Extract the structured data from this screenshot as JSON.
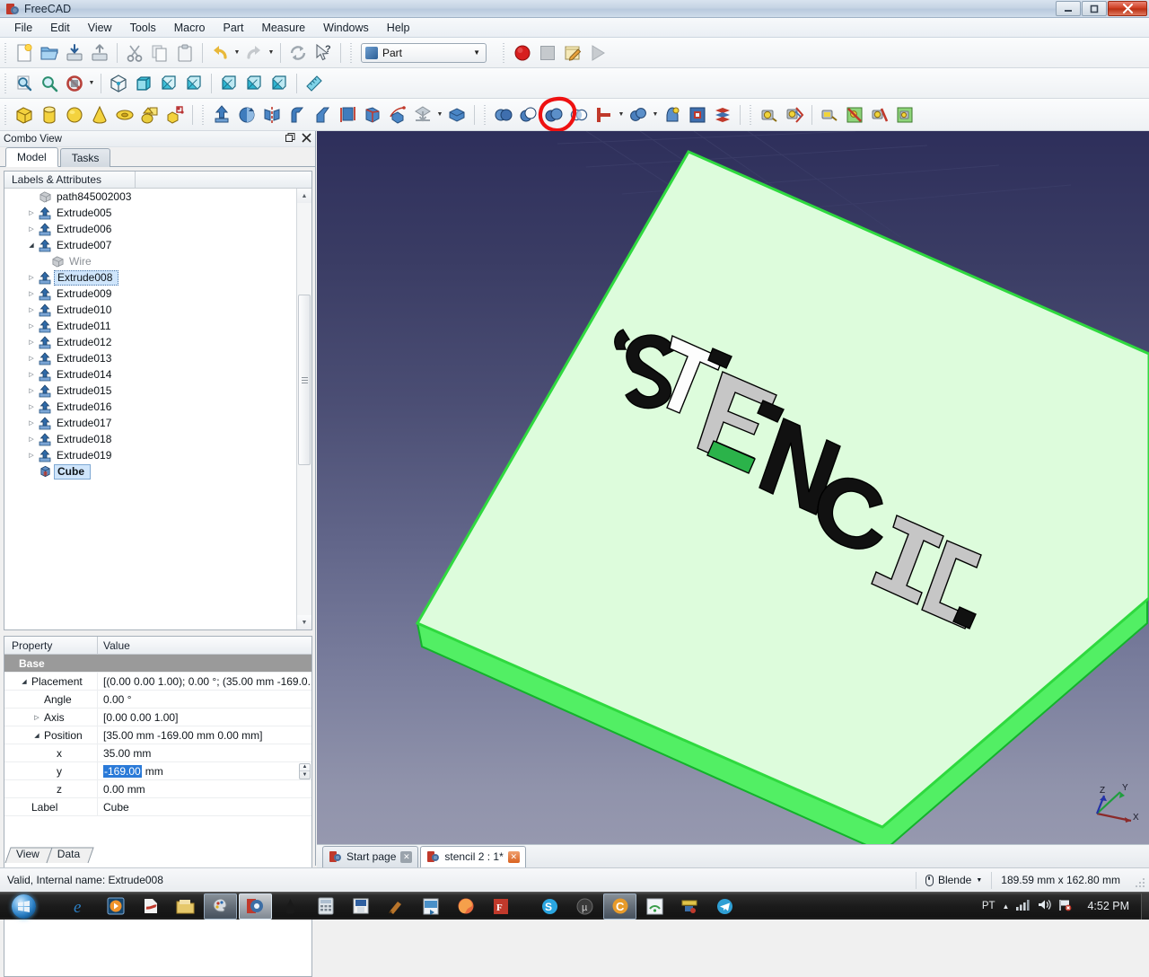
{
  "window": {
    "title": "FreeCAD",
    "app_icon": "freecad-icon",
    "minimize": "–",
    "maximize": "❐",
    "close": "✕"
  },
  "menubar": {
    "items": [
      "File",
      "Edit",
      "View",
      "Tools",
      "Macro",
      "Part",
      "Measure",
      "Windows",
      "Help"
    ]
  },
  "toolbars": {
    "file": [
      {
        "name": "new-document-button",
        "title": "New"
      },
      {
        "name": "open-document-button",
        "title": "Open"
      },
      {
        "name": "save-document-button",
        "title": "Save"
      },
      {
        "name": "save-as-button",
        "title": "Save As"
      },
      {
        "name": "cut-button",
        "title": "Cut"
      },
      {
        "name": "copy-button",
        "title": "Copy"
      },
      {
        "name": "paste-button",
        "title": "Paste"
      },
      {
        "name": "undo-button",
        "title": "Undo"
      },
      {
        "name": "redo-button",
        "title": "Redo"
      },
      {
        "name": "refresh-button",
        "title": "Refresh"
      },
      {
        "name": "whats-this-button",
        "title": "What's This"
      }
    ],
    "workbench": {
      "label": "Part",
      "arrow": "▼"
    },
    "macro": [
      {
        "name": "macro-record-button",
        "title": "Macro recording"
      },
      {
        "name": "macro-stop-button",
        "title": "Stop macro recording"
      },
      {
        "name": "macro-edit-button",
        "title": "Macros"
      },
      {
        "name": "macro-execute-button",
        "title": "Execute macro"
      }
    ],
    "view": [
      {
        "name": "fit-all-button",
        "title": "Fit all"
      },
      {
        "name": "fit-selection-button",
        "title": "Fit selection"
      },
      {
        "name": "draw-style-button",
        "title": "Draw style"
      },
      {
        "name": "isometric-view-button",
        "title": "Isometric"
      },
      {
        "name": "front-view-button",
        "title": "Front"
      },
      {
        "name": "top-view-button",
        "title": "Top"
      },
      {
        "name": "right-view-button",
        "title": "Right"
      },
      {
        "name": "rear-view-button",
        "title": "Rear"
      },
      {
        "name": "bottom-view-button",
        "title": "Bottom"
      },
      {
        "name": "left-view-button",
        "title": "Left"
      },
      {
        "name": "measure-button",
        "title": "Measure"
      }
    ],
    "part_primitives": [
      {
        "name": "box-primitive-button",
        "title": "Box"
      },
      {
        "name": "cylinder-primitive-button",
        "title": "Cylinder"
      },
      {
        "name": "sphere-primitive-button",
        "title": "Sphere"
      },
      {
        "name": "cone-primitive-button",
        "title": "Cone"
      },
      {
        "name": "torus-primitive-button",
        "title": "Torus"
      },
      {
        "name": "create-primitives-button",
        "title": "Create primitives"
      },
      {
        "name": "shape-builder-button",
        "title": "Shape builder"
      }
    ],
    "part_tools": [
      {
        "name": "extrude-button",
        "title": "Extrude"
      },
      {
        "name": "revolve-button",
        "title": "Revolve"
      },
      {
        "name": "mirror-button",
        "title": "Mirror"
      },
      {
        "name": "fillet-button",
        "title": "Fillet"
      },
      {
        "name": "chamfer-button",
        "title": "Chamfer"
      },
      {
        "name": "ruled-surface-button",
        "title": "Ruled surface"
      },
      {
        "name": "loft-button",
        "title": "Loft"
      },
      {
        "name": "sweep-button",
        "title": "Sweep"
      },
      {
        "name": "section-button",
        "title": "Section"
      },
      {
        "name": "offset-button",
        "title": "3D Offset"
      }
    ],
    "boolean": [
      {
        "name": "boolean-button",
        "title": "Boolean"
      },
      {
        "name": "cut-boolean-button",
        "title": "Cut",
        "highlighted": true
      },
      {
        "name": "union-button",
        "title": "Union"
      },
      {
        "name": "intersection-button",
        "title": "Intersection"
      },
      {
        "name": "join-connect-button",
        "title": "Join / Connect"
      },
      {
        "name": "split-button",
        "title": "Split"
      },
      {
        "name": "check-geometry-button",
        "title": "Check geometry"
      },
      {
        "name": "defeaturing-button",
        "title": "Defeaturing"
      },
      {
        "name": "compound-tools-button",
        "title": "Compound tools"
      }
    ],
    "measure_tools": [
      {
        "name": "measure-linear-button",
        "title": "Measure Linear"
      },
      {
        "name": "measure-angular-button",
        "title": "Measure Angular"
      },
      {
        "name": "measure-refresh-button",
        "title": "Measure Refresh"
      },
      {
        "name": "measure-toggle-all-button",
        "title": "Toggle All"
      },
      {
        "name": "measure-clear-all-button",
        "title": "Clear All"
      },
      {
        "name": "measure-toggle-3d-button",
        "title": "Toggle 3D"
      }
    ],
    "highlight_color": "#ee1111"
  },
  "combo_view": {
    "title": "Combo View",
    "float_icon": "undock-icon",
    "close_icon": "close-icon",
    "tabs": [
      {
        "label": "Model",
        "active": true
      },
      {
        "label": "Tasks",
        "active": false
      }
    ],
    "tree": {
      "header": [
        "Labels & Attributes",
        ""
      ],
      "items": [
        {
          "label": "path845002003",
          "icon": "wire-icon",
          "arrow": "none",
          "indent": 1,
          "state": "normal"
        },
        {
          "label": "Extrude005",
          "icon": "extrude-icon",
          "arrow": "collapsed",
          "indent": 1,
          "state": "normal"
        },
        {
          "label": "Extrude006",
          "icon": "extrude-icon",
          "arrow": "collapsed",
          "indent": 1,
          "state": "normal"
        },
        {
          "label": "Extrude007",
          "icon": "extrude-icon",
          "arrow": "expanded",
          "indent": 1,
          "state": "normal"
        },
        {
          "label": "Wire",
          "icon": "wire-icon",
          "arrow": "none",
          "indent": 2,
          "state": "dim"
        },
        {
          "label": "Extrude008",
          "icon": "extrude-icon",
          "arrow": "collapsed",
          "indent": 1,
          "state": "selected"
        },
        {
          "label": "Extrude009",
          "icon": "extrude-icon",
          "arrow": "collapsed",
          "indent": 1,
          "state": "normal"
        },
        {
          "label": "Extrude010",
          "icon": "extrude-icon",
          "arrow": "collapsed",
          "indent": 1,
          "state": "normal"
        },
        {
          "label": "Extrude011",
          "icon": "extrude-icon",
          "arrow": "collapsed",
          "indent": 1,
          "state": "normal"
        },
        {
          "label": "Extrude012",
          "icon": "extrude-icon",
          "arrow": "collapsed",
          "indent": 1,
          "state": "normal"
        },
        {
          "label": "Extrude013",
          "icon": "extrude-icon",
          "arrow": "collapsed",
          "indent": 1,
          "state": "normal"
        },
        {
          "label": "Extrude014",
          "icon": "extrude-icon",
          "arrow": "collapsed",
          "indent": 1,
          "state": "normal"
        },
        {
          "label": "Extrude015",
          "icon": "extrude-icon",
          "arrow": "collapsed",
          "indent": 1,
          "state": "normal"
        },
        {
          "label": "Extrude016",
          "icon": "extrude-icon",
          "arrow": "collapsed",
          "indent": 1,
          "state": "normal"
        },
        {
          "label": "Extrude017",
          "icon": "extrude-icon",
          "arrow": "collapsed",
          "indent": 1,
          "state": "normal"
        },
        {
          "label": "Extrude018",
          "icon": "extrude-icon",
          "arrow": "collapsed",
          "indent": 1,
          "state": "normal"
        },
        {
          "label": "Extrude019",
          "icon": "extrude-icon",
          "arrow": "collapsed",
          "indent": 1,
          "state": "normal"
        },
        {
          "label": "Cube",
          "icon": "cube-icon",
          "arrow": "none",
          "indent": 1,
          "state": "selected-bold"
        }
      ]
    },
    "properties": {
      "header": [
        "Property",
        "Value"
      ],
      "rows": [
        {
          "name": "Base",
          "value": "",
          "type": "group",
          "indent": 0,
          "expander": "none"
        },
        {
          "name": "Placement",
          "value": "[(0.00 0.00 1.00); 0.00 °; (35.00 mm  -169.0...",
          "type": "row",
          "indent": 1,
          "expander": "expanded"
        },
        {
          "name": "Angle",
          "value": "0.00 °",
          "type": "row",
          "indent": 2,
          "expander": "none"
        },
        {
          "name": "Axis",
          "value": "[0.00 0.00 1.00]",
          "type": "row",
          "indent": 2,
          "expander": "collapsed"
        },
        {
          "name": "Position",
          "value": "[35.00 mm  -169.00 mm  0.00 mm]",
          "type": "row",
          "indent": 2,
          "expander": "expanded"
        },
        {
          "name": "x",
          "value": "35.00 mm",
          "type": "row",
          "indent": 3,
          "expander": "none"
        },
        {
          "name": "y",
          "value": "-169.00",
          "unit": "mm",
          "type": "editing",
          "indent": 3,
          "expander": "none"
        },
        {
          "name": "z",
          "value": "0.00 mm",
          "type": "row",
          "indent": 3,
          "expander": "none"
        },
        {
          "name": "Label",
          "value": "Cube",
          "type": "row",
          "indent": 1,
          "expander": "none"
        }
      ]
    },
    "bottom_tabs": [
      {
        "label": "View",
        "active": false
      },
      {
        "label": "Data",
        "active": true
      }
    ]
  },
  "view3d": {
    "model_text": "STENCIL",
    "plate_face_color": "#ddfcdc",
    "plate_edge_color": "#4cf04c",
    "plate_side_color": "#52ef64",
    "background_top": "#2e2f5b",
    "background_bottom": "#9698af",
    "axis_labels": [
      "X",
      "Y",
      "Z"
    ],
    "axis_colors": {
      "x": "#8b2a2a",
      "y": "#1f9e3e",
      "z": "#2432a8"
    }
  },
  "mdi_tabs": [
    {
      "label": "Start page",
      "active": false,
      "close": "✕"
    },
    {
      "label": "stencil 2 : 1*",
      "active": true,
      "close": "✕"
    }
  ],
  "statusbar": {
    "message": "Valid, Internal name: Extrude008",
    "navigation_style": "Blende",
    "navigation_arrow": "▼",
    "dimensions": "189.59 mm x 162.80 mm"
  },
  "taskbar": {
    "start_label": "start-orb",
    "items": [
      {
        "name": "taskbar-internet-explorer",
        "state": "idle"
      },
      {
        "name": "taskbar-media-player",
        "state": "idle"
      },
      {
        "name": "taskbar-pdf-reader",
        "state": "idle"
      },
      {
        "name": "taskbar-file-explorer",
        "state": "idle"
      },
      {
        "name": "taskbar-paint",
        "state": "active"
      },
      {
        "name": "taskbar-freecad",
        "state": "active-focused"
      },
      {
        "name": "taskbar-inkscape",
        "state": "idle"
      },
      {
        "name": "taskbar-calculator",
        "state": "idle"
      },
      {
        "name": "taskbar-floppy-app",
        "state": "idle"
      },
      {
        "name": "taskbar-gimp",
        "state": "idle"
      },
      {
        "name": "taskbar-video-app",
        "state": "idle"
      },
      {
        "name": "taskbar-firefox",
        "state": "idle"
      },
      {
        "name": "taskbar-pdf-app",
        "state": "idle"
      },
      {
        "name": "taskbar-skype",
        "state": "idle"
      },
      {
        "name": "taskbar-utorrent",
        "state": "idle"
      },
      {
        "name": "taskbar-chrome-app",
        "state": "active"
      },
      {
        "name": "taskbar-wifi-app",
        "state": "idle"
      },
      {
        "name": "taskbar-ruler-app",
        "state": "idle"
      },
      {
        "name": "taskbar-telegram",
        "state": "idle"
      }
    ],
    "tray": {
      "language": "PT",
      "show_hidden": "▲",
      "network_icon": "signal-bars-icon",
      "volume_icon": "speaker-icon",
      "action_center_icon": "flag-icon",
      "clock": "4:52 PM"
    }
  }
}
